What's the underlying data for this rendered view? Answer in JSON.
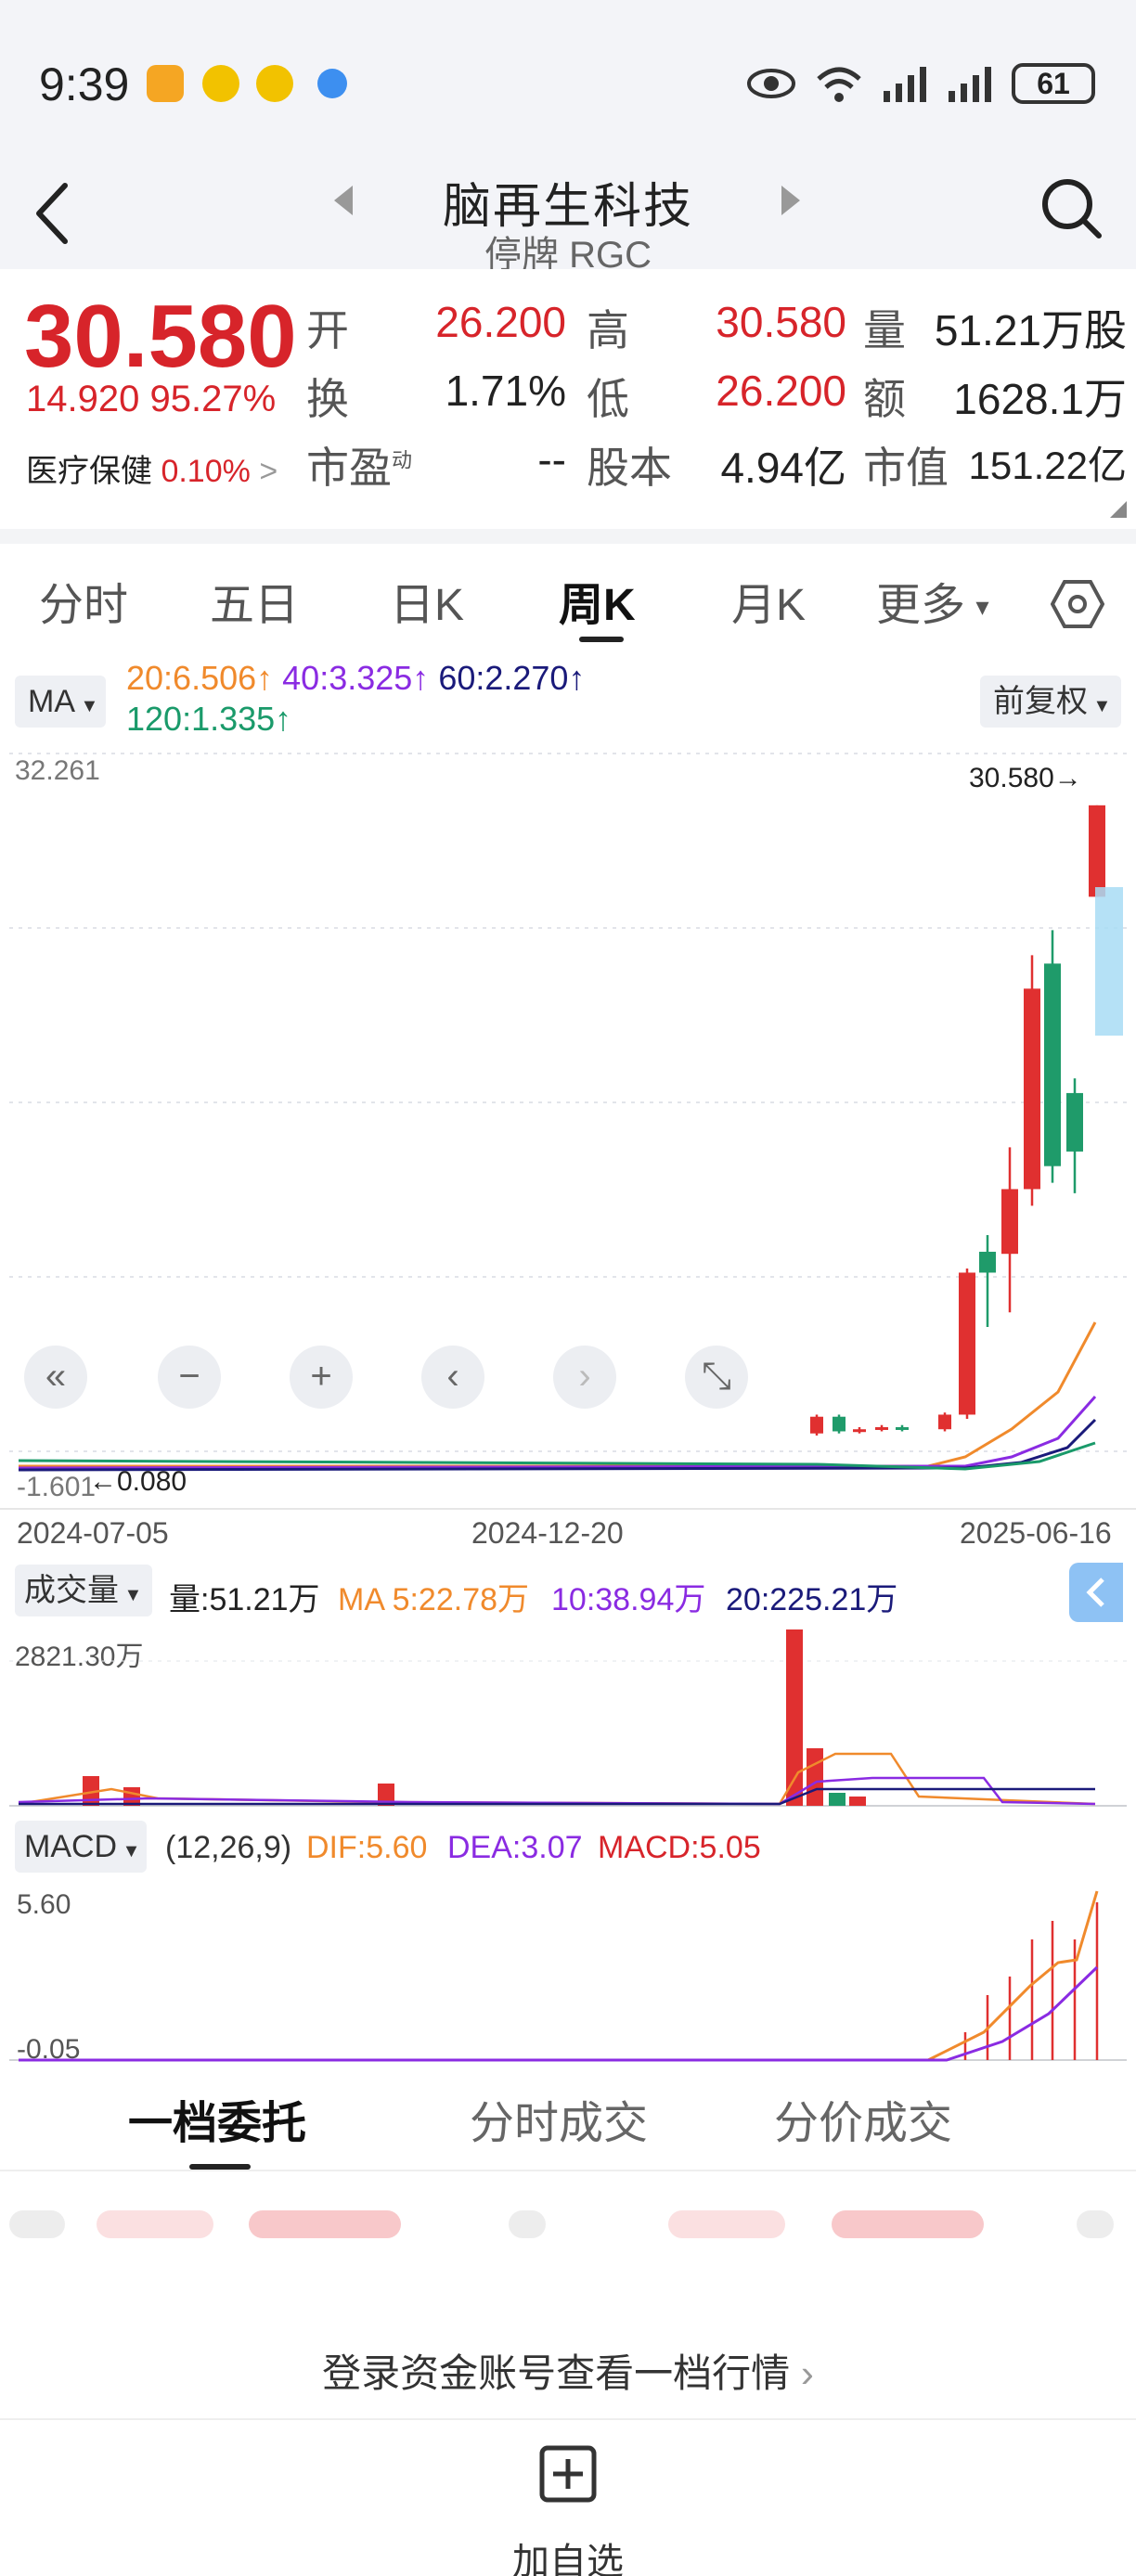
{
  "status_bar": {
    "time": "9:39",
    "battery": "61",
    "network": "6"
  },
  "header": {
    "name": "脑再生科技",
    "status": "停牌",
    "ticker": "RGC"
  },
  "quote": {
    "price": "30.580",
    "change": "14.920",
    "change_pct": "95.27%",
    "sector_name": "医疗保健",
    "sector_pct": "0.10%",
    "labels": {
      "open": "开",
      "high": "高",
      "volume": "量",
      "turnover": "换",
      "low": "低",
      "amount": "额",
      "pe": "市盈",
      "pe_sup": "动",
      "shares": "股本",
      "mcap": "市值"
    },
    "values": {
      "open": "26.200",
      "high": "30.580",
      "volume": "51.21万股",
      "turnover": "1.71%",
      "low": "26.200",
      "amount": "1628.1万",
      "pe": "--",
      "shares": "4.94亿",
      "mcap": "151.22亿"
    }
  },
  "tabs": [
    "分时",
    "五日",
    "日K",
    "周K",
    "月K",
    "更多"
  ],
  "active_tab": "周K",
  "chart_toolbar": {
    "ma_button": "MA",
    "ma20": "20:6.506",
    "ma40": "40:3.325",
    "ma60": "60:2.270",
    "ma120": "120:1.335",
    "adjust_button": "前复权",
    "colors": {
      "ma20": "#f08a2c",
      "ma40": "#8a2be2",
      "ma60": "#1a1a7a",
      "ma120": "#1a9a6a"
    }
  },
  "chart_data": {
    "type": "candlestick",
    "y_max_label": "32.261",
    "y_min_label": "-1.601",
    "last_price_label": "30.580",
    "low_marker": "0.080",
    "x_ticks": [
      "2024-07-05",
      "2024-12-20",
      "2025-06-16"
    ],
    "ylim": [
      -1.601,
      32.261
    ],
    "candles": [
      {
        "o": 0.5,
        "c": 1.3,
        "h": 1.4,
        "l": 0.4,
        "up": true
      },
      {
        "o": 1.3,
        "c": 0.6,
        "h": 1.4,
        "l": 0.5,
        "up": false
      },
      {
        "o": 0.6,
        "c": 0.7,
        "h": 0.8,
        "l": 0.5,
        "up": true
      },
      {
        "o": 0.7,
        "c": 0.8,
        "h": 0.9,
        "l": 0.6,
        "up": true
      },
      {
        "o": 0.8,
        "c": 0.7,
        "h": 0.9,
        "l": 0.6,
        "up": false
      },
      {
        "o": 0.7,
        "c": 1.4,
        "h": 1.5,
        "l": 0.6,
        "up": true
      },
      {
        "o": 1.4,
        "c": 8.2,
        "h": 8.4,
        "l": 1.2,
        "up": true
      },
      {
        "o": 8.2,
        "c": 9.2,
        "h": 10.0,
        "l": 5.6,
        "up": false
      },
      {
        "o": 9.1,
        "c": 12.2,
        "h": 14.2,
        "l": 6.3,
        "up": true
      },
      {
        "o": 12.2,
        "c": 21.8,
        "h": 23.4,
        "l": 11.4,
        "up": true
      },
      {
        "o": 23.0,
        "c": 13.3,
        "h": 24.6,
        "l": 12.5,
        "up": false
      },
      {
        "o": 16.8,
        "c": 14.0,
        "h": 17.5,
        "l": 12.0,
        "up": false
      },
      {
        "o": 26.2,
        "c": 30.58,
        "h": 30.58,
        "l": 26.2,
        "up": true
      }
    ],
    "zoom_buttons": [
      "«",
      "−",
      "+",
      "‹",
      "›",
      "⤡"
    ]
  },
  "volume": {
    "button": "成交量",
    "volume": "量:51.21万",
    "ma5": "MA 5:22.78万",
    "ma10": "10:38.94万",
    "ma20": "20:225.21万",
    "max_label": "2821.30万"
  },
  "macd": {
    "button": "MACD",
    "params": "(12,26,9)",
    "dif": "DIF:5.60",
    "dea": "DEA:3.07",
    "macd": "MACD:5.05",
    "max_label": "5.60",
    "min_label": "-0.05"
  },
  "order_tabs": [
    "一档委托",
    "分时成交",
    "分价成交"
  ],
  "login_link": "登录资金账号查看一档行情",
  "bottom": {
    "add_label": "加自选"
  }
}
